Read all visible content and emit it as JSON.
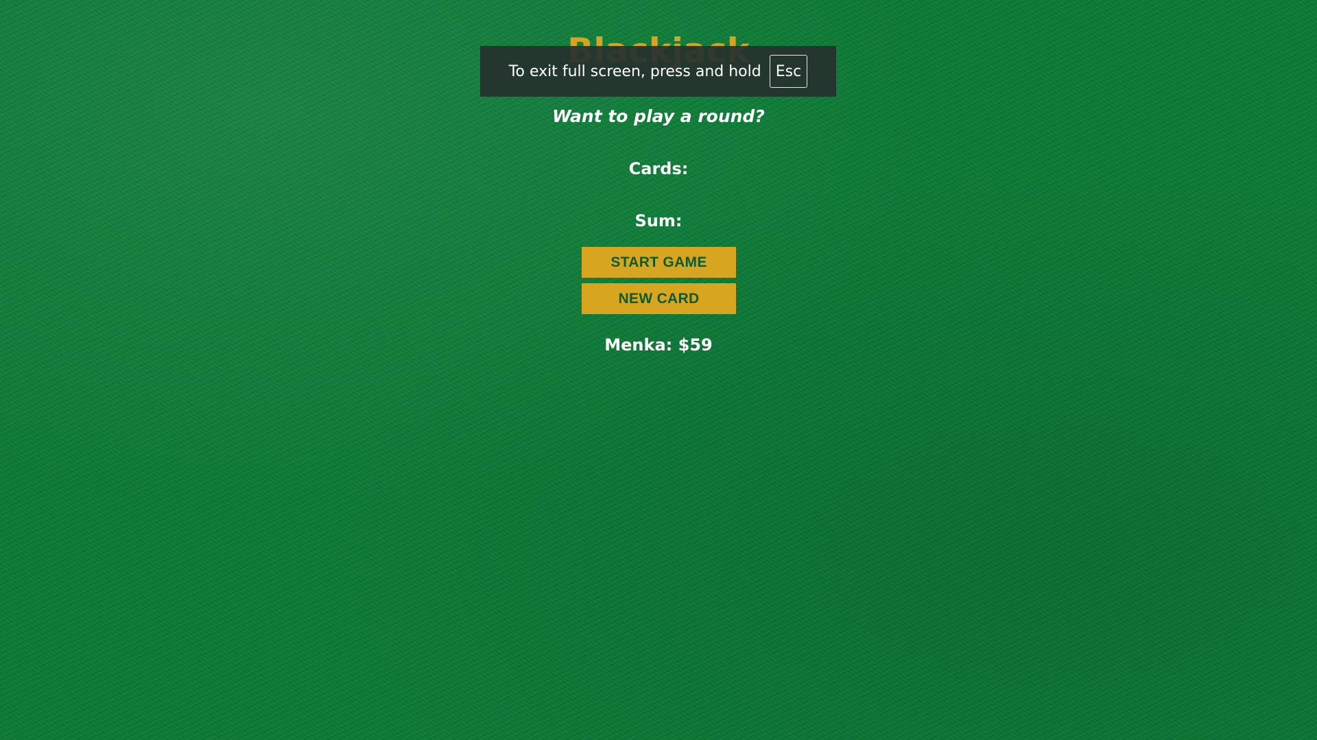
{
  "game": {
    "title": "Blackjack",
    "message": "Want to play a round?",
    "cards_label": "Cards:",
    "sum_label": "Sum:",
    "start_button": "START GAME",
    "new_card_button": "NEW CARD",
    "player_info": "Menka: $59"
  },
  "fullscreen_notice": {
    "text": "To exit full screen, press and hold",
    "key": "Esc"
  },
  "colors": {
    "felt": "#0a7a35",
    "accent": "#d8a521",
    "button_text": "#0f5a2c",
    "text": "#ffffff"
  }
}
